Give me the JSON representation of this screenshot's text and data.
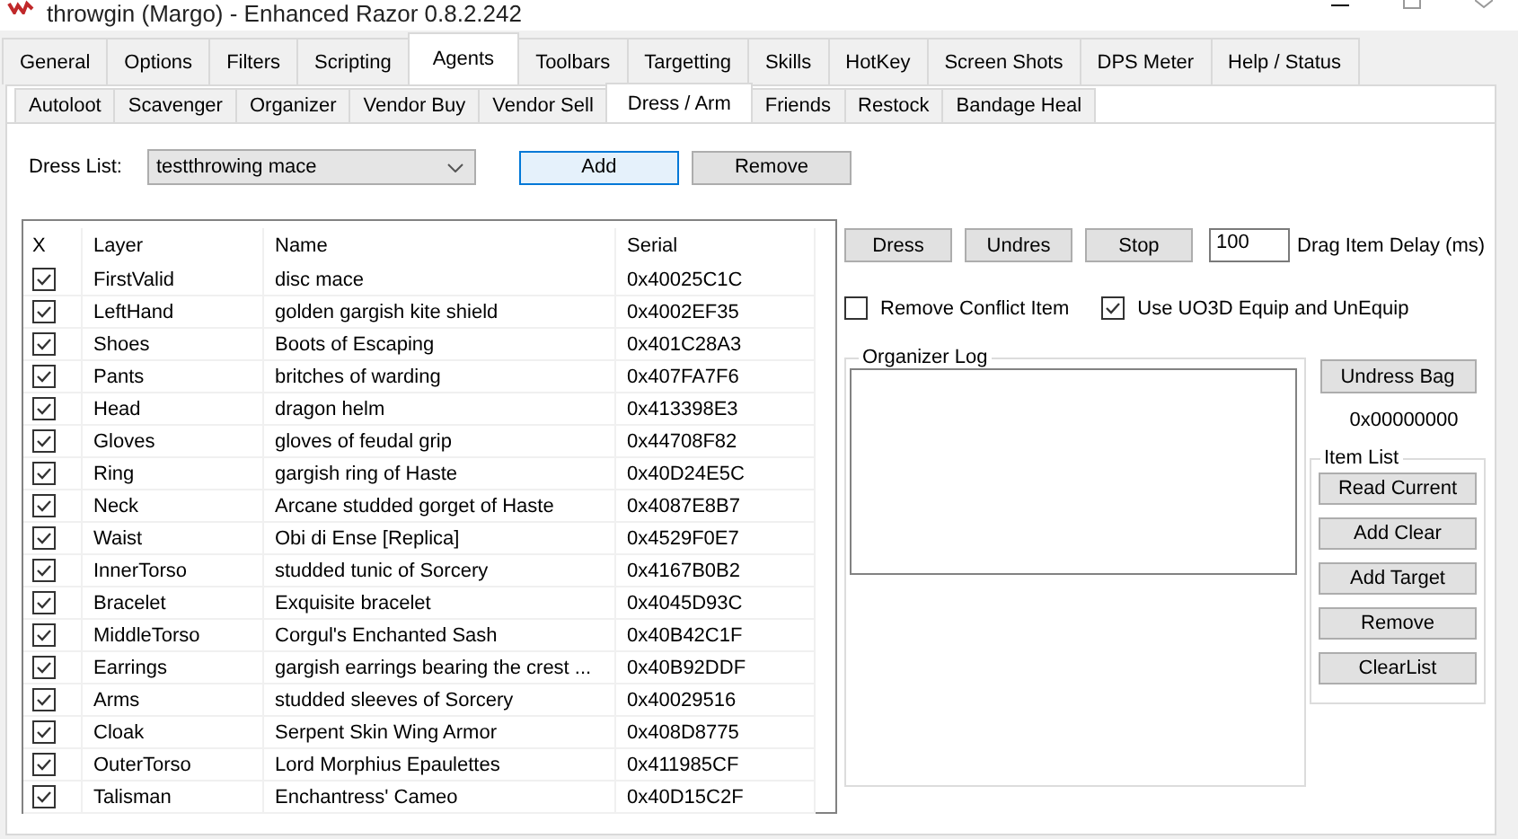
{
  "window": {
    "title": "throwgin (Margo) - Enhanced Razor 0.8.2.242"
  },
  "tabs": [
    {
      "label": "General",
      "selected": false
    },
    {
      "label": "Options",
      "selected": false
    },
    {
      "label": "Filters",
      "selected": false
    },
    {
      "label": "Scripting",
      "selected": false
    },
    {
      "label": "Agents",
      "selected": true
    },
    {
      "label": "Toolbars",
      "selected": false
    },
    {
      "label": "Targetting",
      "selected": false
    },
    {
      "label": "Skills",
      "selected": false
    },
    {
      "label": "HotKey",
      "selected": false
    },
    {
      "label": "Screen Shots",
      "selected": false
    },
    {
      "label": "DPS Meter",
      "selected": false
    },
    {
      "label": "Help / Status",
      "selected": false
    }
  ],
  "subtabs": [
    {
      "label": "Autoloot",
      "selected": false
    },
    {
      "label": "Scavenger",
      "selected": false
    },
    {
      "label": "Organizer",
      "selected": false
    },
    {
      "label": "Vendor Buy",
      "selected": false
    },
    {
      "label": "Vendor Sell",
      "selected": false
    },
    {
      "label": "Dress / Arm",
      "selected": true
    },
    {
      "label": "Friends",
      "selected": false
    },
    {
      "label": "Restock",
      "selected": false
    },
    {
      "label": "Bandage Heal",
      "selected": false
    }
  ],
  "dress_list": {
    "label": "Dress List:",
    "value": "testthrowing mace"
  },
  "list_buttons": [
    {
      "label": "Add",
      "focused": true
    },
    {
      "label": "Remove",
      "focused": false
    }
  ],
  "table": {
    "columns": [
      "X",
      "Layer",
      "Name",
      "Serial"
    ],
    "rows": [
      {
        "checked": true,
        "layer": "FirstValid",
        "name": "disc mace",
        "serial": "0x40025C1C"
      },
      {
        "checked": true,
        "layer": "LeftHand",
        "name": "golden gargish kite shield",
        "serial": "0x4002EF35"
      },
      {
        "checked": true,
        "layer": "Shoes",
        "name": "Boots of Escaping",
        "serial": "0x401C28A3"
      },
      {
        "checked": true,
        "layer": "Pants",
        "name": "britches of warding",
        "serial": "0x407FA7F6"
      },
      {
        "checked": true,
        "layer": "Head",
        "name": "dragon helm",
        "serial": "0x413398E3"
      },
      {
        "checked": true,
        "layer": "Gloves",
        "name": "gloves of feudal grip",
        "serial": "0x44708F82"
      },
      {
        "checked": true,
        "layer": "Ring",
        "name": "gargish ring of Haste",
        "serial": "0x40D24E5C"
      },
      {
        "checked": true,
        "layer": "Neck",
        "name": "Arcane studded gorget of Haste",
        "serial": "0x4087E8B7"
      },
      {
        "checked": true,
        "layer": "Waist",
        "name": "Obi di Ense [Replica]",
        "serial": "0x4529F0E7"
      },
      {
        "checked": true,
        "layer": "InnerTorso",
        "name": "studded tunic of Sorcery",
        "serial": "0x4167B0B2"
      },
      {
        "checked": true,
        "layer": "Bracelet",
        "name": "Exquisite bracelet",
        "serial": "0x4045D93C"
      },
      {
        "checked": true,
        "layer": "MiddleTorso",
        "name": "Corgul's Enchanted Sash",
        "serial": "0x40B42C1F"
      },
      {
        "checked": true,
        "layer": "Earrings",
        "name": "gargish earrings bearing the crest ...",
        "serial": "0x40B92DDF"
      },
      {
        "checked": true,
        "layer": "Arms",
        "name": "studded sleeves of Sorcery",
        "serial": "0x40029516"
      },
      {
        "checked": true,
        "layer": "Cloak",
        "name": "Serpent Skin Wing Armor",
        "serial": "0x408D8775"
      },
      {
        "checked": true,
        "layer": "OuterTorso",
        "name": "Lord Morphius Epaulettes",
        "serial": "0x411985CF"
      },
      {
        "checked": true,
        "layer": "Talisman",
        "name": "Enchantress' Cameo",
        "serial": "0x40D15C2F"
      }
    ]
  },
  "actions": [
    "Dress",
    "Undres",
    "Stop"
  ],
  "delay": {
    "value": "100",
    "label": "Drag Item Delay (ms)"
  },
  "options": [
    {
      "label": "Remove Conflict Item",
      "checked": false
    },
    {
      "label": "Use UO3D Equip and UnEquip",
      "checked": true
    }
  ],
  "organizer_log": {
    "title": "Organizer Log"
  },
  "undress_bag": {
    "button": "Undress Bag",
    "serial": "0x00000000"
  },
  "item_list": {
    "title": "Item List",
    "buttons": [
      "Read Current",
      "Add Clear",
      "Add Target",
      "Remove",
      "ClearList"
    ]
  }
}
